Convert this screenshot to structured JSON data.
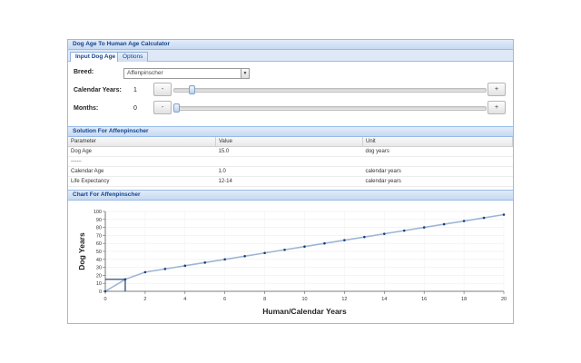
{
  "window": {
    "title": "Dog Age To Human Age Calculator"
  },
  "tabs": [
    {
      "label": "Input Dog Age",
      "active": true
    },
    {
      "label": "Options",
      "active": false
    }
  ],
  "form": {
    "breed_label": "Breed:",
    "breed_value": "Affenpinscher",
    "calendar_years_label": "Calendar Years:",
    "calendar_years_value": "1",
    "months_label": "Months:",
    "months_value": "0",
    "minus_label": "-",
    "plus_label": "+",
    "calendar_years_slider": {
      "value": 1,
      "min": 0,
      "max": 20
    },
    "months_slider": {
      "value": 0,
      "min": 0,
      "max": 11
    }
  },
  "solution": {
    "title": "Solution For Affenpinscher",
    "columns": [
      "Parameter",
      "Value",
      "Unit"
    ],
    "rows": [
      [
        "Dog Age",
        "15.0",
        "dog years"
      ],
      [
        "-------",
        "",
        ""
      ],
      [
        "Calendar Age",
        "1.0",
        "calendar years"
      ],
      [
        "Life Expectancy",
        "12-14",
        "calendar years"
      ]
    ]
  },
  "chart_panel": {
    "title": "Chart For Affenpinscher"
  },
  "chart_data": {
    "type": "line",
    "xlabel": "Human/Calendar Years",
    "ylabel": "Dog Years",
    "xlim": [
      0,
      20
    ],
    "ylim": [
      0,
      100
    ],
    "x_ticks": [
      0,
      2,
      4,
      6,
      8,
      10,
      12,
      14,
      16,
      18,
      20
    ],
    "y_ticks": [
      0,
      10,
      20,
      30,
      40,
      50,
      60,
      70,
      80,
      90,
      100
    ],
    "series": [
      {
        "x": [
          0,
          1,
          2,
          3,
          4,
          5,
          6,
          7,
          8,
          9,
          10,
          11,
          12,
          13,
          14,
          15,
          16,
          17,
          18,
          19,
          20
        ],
        "y": [
          0,
          15,
          24,
          28,
          32,
          36,
          40,
          44,
          48,
          52,
          56,
          60,
          64,
          68,
          72,
          76,
          80,
          84,
          88,
          92,
          96
        ]
      }
    ],
    "marker": {
      "x": 1,
      "y": 15
    },
    "colors": {
      "line": "#9eb6d6",
      "points": "#1f3f7a",
      "marker": "#1f3a6e"
    }
  }
}
